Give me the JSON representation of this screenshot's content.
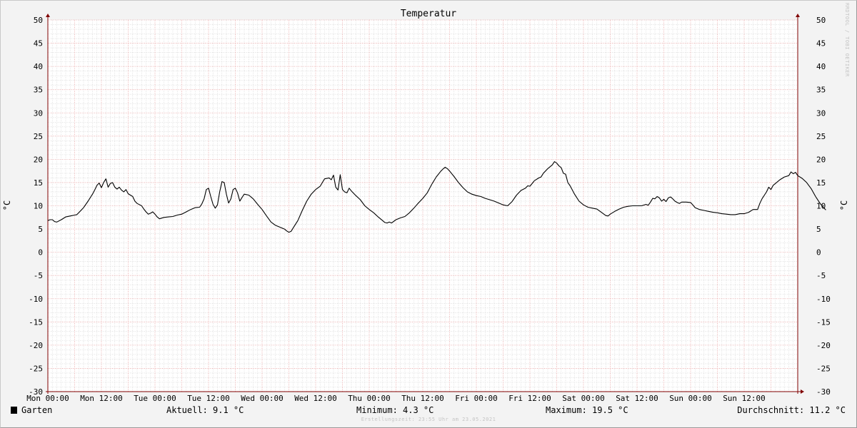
{
  "chart_data": {
    "type": "line",
    "title": "Temperatur",
    "ylabel": "°C",
    "ylim": [
      -30,
      50
    ],
    "yticks": [
      50,
      45,
      40,
      35,
      30,
      25,
      20,
      15,
      10,
      5,
      0,
      -5,
      -10,
      -15,
      -20,
      -25,
      -30
    ],
    "xrange_hours": [
      0,
      168
    ],
    "xticks": [
      {
        "hour": 0,
        "label": "Mon 00:00"
      },
      {
        "hour": 12,
        "label": "Mon 12:00"
      },
      {
        "hour": 24,
        "label": "Tue 00:00"
      },
      {
        "hour": 36,
        "label": "Tue 12:00"
      },
      {
        "hour": 48,
        "label": "Wed 00:00"
      },
      {
        "hour": 60,
        "label": "Wed 12:00"
      },
      {
        "hour": 72,
        "label": "Thu 00:00"
      },
      {
        "hour": 84,
        "label": "Thu 12:00"
      },
      {
        "hour": 96,
        "label": "Fri 00:00"
      },
      {
        "hour": 108,
        "label": "Fri 12:00"
      },
      {
        "hour": 120,
        "label": "Sat 00:00"
      },
      {
        "hour": 132,
        "label": "Sat 12:00"
      },
      {
        "hour": 144,
        "label": "Sun 00:00"
      },
      {
        "hour": 156,
        "label": "Sun 12:00"
      }
    ],
    "grid": true,
    "series": [
      {
        "name": "Garten",
        "color": "#000000",
        "points": [
          [
            0,
            6.8
          ],
          [
            0.5,
            7.0
          ],
          [
            1,
            7.0
          ],
          [
            1.5,
            6.6
          ],
          [
            2,
            6.5
          ],
          [
            3,
            7.0
          ],
          [
            4,
            7.6
          ],
          [
            5,
            7.8
          ],
          [
            6,
            8.0
          ],
          [
            6.5,
            8.1
          ],
          [
            7,
            8.6
          ],
          [
            8,
            9.6
          ],
          [
            9,
            11.0
          ],
          [
            10,
            12.5
          ],
          [
            10.5,
            13.4
          ],
          [
            11,
            14.4
          ],
          [
            11.5,
            14.9
          ],
          [
            12,
            13.9
          ],
          [
            12.5,
            15.0
          ],
          [
            13,
            15.8
          ],
          [
            13.5,
            14.0
          ],
          [
            14,
            14.8
          ],
          [
            14.5,
            15.0
          ],
          [
            15,
            14.0
          ],
          [
            15.5,
            13.6
          ],
          [
            16,
            14.0
          ],
          [
            16.5,
            13.4
          ],
          [
            17,
            13.0
          ],
          [
            17.5,
            13.5
          ],
          [
            18,
            12.6
          ],
          [
            19,
            12.0
          ],
          [
            19.5,
            11.0
          ],
          [
            20,
            10.5
          ],
          [
            21,
            10.0
          ],
          [
            21.5,
            9.3
          ],
          [
            22,
            8.7
          ],
          [
            22.5,
            8.2
          ],
          [
            23,
            8.4
          ],
          [
            23.5,
            8.7
          ],
          [
            24,
            8.2
          ],
          [
            24.5,
            7.6
          ],
          [
            25,
            7.2
          ],
          [
            26,
            7.5
          ],
          [
            27,
            7.6
          ],
          [
            28,
            7.7
          ],
          [
            29,
            8.0
          ],
          [
            30,
            8.2
          ],
          [
            31,
            8.7
          ],
          [
            32,
            9.2
          ],
          [
            33,
            9.6
          ],
          [
            34,
            9.7
          ],
          [
            34.5,
            10.4
          ],
          [
            35,
            11.5
          ],
          [
            35.5,
            13.5
          ],
          [
            36,
            13.8
          ],
          [
            36.5,
            12.0
          ],
          [
            37,
            10.3
          ],
          [
            37.5,
            9.5
          ],
          [
            38,
            10.2
          ],
          [
            38.5,
            13.0
          ],
          [
            39,
            15.2
          ],
          [
            39.5,
            15.0
          ],
          [
            40,
            12.5
          ],
          [
            40.5,
            10.6
          ],
          [
            41,
            11.5
          ],
          [
            41.5,
            13.5
          ],
          [
            42,
            13.8
          ],
          [
            42.5,
            12.8
          ],
          [
            43,
            11.0
          ],
          [
            43.5,
            11.8
          ],
          [
            44,
            12.5
          ],
          [
            45,
            12.3
          ],
          [
            46,
            11.5
          ],
          [
            47,
            10.3
          ],
          [
            48,
            9.2
          ],
          [
            49,
            7.8
          ],
          [
            50,
            6.5
          ],
          [
            51,
            5.8
          ],
          [
            52,
            5.4
          ],
          [
            53,
            5.0
          ],
          [
            53.5,
            4.6
          ],
          [
            54,
            4.3
          ],
          [
            54.5,
            4.5
          ],
          [
            55,
            5.3
          ],
          [
            56,
            6.8
          ],
          [
            57,
            9.0
          ],
          [
            58,
            11.0
          ],
          [
            59,
            12.5
          ],
          [
            60,
            13.5
          ],
          [
            61,
            14.2
          ],
          [
            61.5,
            15.0
          ],
          [
            62,
            15.8
          ],
          [
            63,
            16.0
          ],
          [
            63.5,
            15.6
          ],
          [
            64,
            16.6
          ],
          [
            64.5,
            14.0
          ],
          [
            65,
            13.4
          ],
          [
            65.5,
            16.7
          ],
          [
            66,
            13.5
          ],
          [
            66.5,
            13.0
          ],
          [
            67,
            12.8
          ],
          [
            67.5,
            13.8
          ],
          [
            68,
            13.2
          ],
          [
            69,
            12.2
          ],
          [
            70,
            11.3
          ],
          [
            71,
            10.0
          ],
          [
            72,
            9.2
          ],
          [
            73,
            8.5
          ],
          [
            74,
            7.6
          ],
          [
            75,
            6.8
          ],
          [
            75.5,
            6.4
          ],
          [
            76,
            6.3
          ],
          [
            76.5,
            6.5
          ],
          [
            77,
            6.3
          ],
          [
            78,
            7.0
          ],
          [
            79,
            7.4
          ],
          [
            80,
            7.7
          ],
          [
            81,
            8.5
          ],
          [
            82,
            9.5
          ],
          [
            83,
            10.6
          ],
          [
            84,
            11.6
          ],
          [
            85,
            12.8
          ],
          [
            86,
            14.6
          ],
          [
            87,
            16.2
          ],
          [
            88,
            17.4
          ],
          [
            88.5,
            17.9
          ],
          [
            89,
            18.3
          ],
          [
            89.5,
            18.0
          ],
          [
            90,
            17.5
          ],
          [
            91,
            16.3
          ],
          [
            92,
            15.0
          ],
          [
            93,
            13.9
          ],
          [
            94,
            13.0
          ],
          [
            95,
            12.5
          ],
          [
            96,
            12.2
          ],
          [
            97,
            12.0
          ],
          [
            98,
            11.6
          ],
          [
            99,
            11.3
          ],
          [
            100,
            11.0
          ],
          [
            101,
            10.6
          ],
          [
            102,
            10.2
          ],
          [
            103,
            10.0
          ],
          [
            104,
            10.9
          ],
          [
            105,
            12.3
          ],
          [
            106,
            13.3
          ],
          [
            107,
            13.8
          ],
          [
            107.5,
            14.3
          ],
          [
            108,
            14.2
          ],
          [
            109,
            15.4
          ],
          [
            110,
            16.0
          ],
          [
            110.5,
            16.2
          ],
          [
            111,
            17.0
          ],
          [
            112,
            18.0
          ],
          [
            113,
            18.8
          ],
          [
            113.5,
            19.5
          ],
          [
            114,
            19.2
          ],
          [
            114.5,
            18.6
          ],
          [
            115,
            18.2
          ],
          [
            115.5,
            17.0
          ],
          [
            116,
            16.8
          ],
          [
            116.5,
            15.0
          ],
          [
            117,
            14.3
          ],
          [
            118,
            12.5
          ],
          [
            119,
            11.0
          ],
          [
            120,
            10.2
          ],
          [
            121,
            9.7
          ],
          [
            122,
            9.5
          ],
          [
            123,
            9.3
          ],
          [
            124,
            8.6
          ],
          [
            125,
            7.9
          ],
          [
            125.5,
            7.8
          ],
          [
            126,
            8.2
          ],
          [
            127,
            8.8
          ],
          [
            128,
            9.3
          ],
          [
            129,
            9.7
          ],
          [
            130,
            9.9
          ],
          [
            131,
            10.0
          ],
          [
            132,
            10.0
          ],
          [
            133,
            10.0
          ],
          [
            134,
            10.3
          ],
          [
            134.5,
            10.1
          ],
          [
            135,
            10.8
          ],
          [
            135.5,
            11.6
          ],
          [
            136,
            11.5
          ],
          [
            136.5,
            12.0
          ],
          [
            137,
            11.7
          ],
          [
            137.5,
            11.0
          ],
          [
            138,
            11.4
          ],
          [
            138.5,
            10.9
          ],
          [
            139,
            11.7
          ],
          [
            139.5,
            11.9
          ],
          [
            140,
            11.5
          ],
          [
            140.5,
            11.0
          ],
          [
            141,
            10.7
          ],
          [
            141.5,
            10.5
          ],
          [
            142,
            10.8
          ],
          [
            143,
            10.8
          ],
          [
            144,
            10.7
          ],
          [
            144.5,
            10.2
          ],
          [
            145,
            9.6
          ],
          [
            146,
            9.2
          ],
          [
            147,
            9.0
          ],
          [
            148,
            8.8
          ],
          [
            149,
            8.6
          ],
          [
            150,
            8.5
          ],
          [
            151,
            8.3
          ],
          [
            152,
            8.2
          ],
          [
            153,
            8.1
          ],
          [
            154,
            8.1
          ],
          [
            155,
            8.3
          ],
          [
            156,
            8.3
          ],
          [
            157,
            8.6
          ],
          [
            158,
            9.2
          ],
          [
            159,
            9.2
          ],
          [
            159.5,
            10.5
          ],
          [
            160,
            11.5
          ],
          [
            161,
            13.0
          ],
          [
            161.5,
            14.0
          ],
          [
            162,
            13.5
          ],
          [
            162.5,
            14.4
          ],
          [
            163,
            14.8
          ],
          [
            164,
            15.6
          ],
          [
            165,
            16.2
          ],
          [
            166,
            16.5
          ],
          [
            166.5,
            17.3
          ],
          [
            167,
            16.9
          ],
          [
            167.5,
            17.2
          ],
          [
            168,
            16.5
          ],
          [
            169,
            15.9
          ],
          [
            170,
            15.0
          ],
          [
            171,
            13.7
          ],
          [
            172,
            12.0
          ],
          [
            173,
            10.5
          ],
          [
            173.8,
            9.6
          ],
          [
            174.3,
            9.1
          ]
        ]
      }
    ]
  },
  "legend": {
    "series_name": "Garten",
    "current": "Aktuell: 9.1 °C",
    "minimum": "Minimum: 4.3 °C",
    "maximum": "Maximum: 19.5 °C",
    "average": "Durchschnitt: 11.2 °C"
  },
  "footer": {
    "created": "Erstellungszeit: 23:55 Uhr am 23.05.2021",
    "watermark": "RRDTOOL / TOBI OETIKER"
  },
  "colors": {
    "background": "#f3f3f3",
    "plot_background": "#ffffff",
    "major_grid": "#e8a0a0",
    "minor_grid": "#cfcfcf",
    "axis": "#800000",
    "line": "#000000"
  }
}
